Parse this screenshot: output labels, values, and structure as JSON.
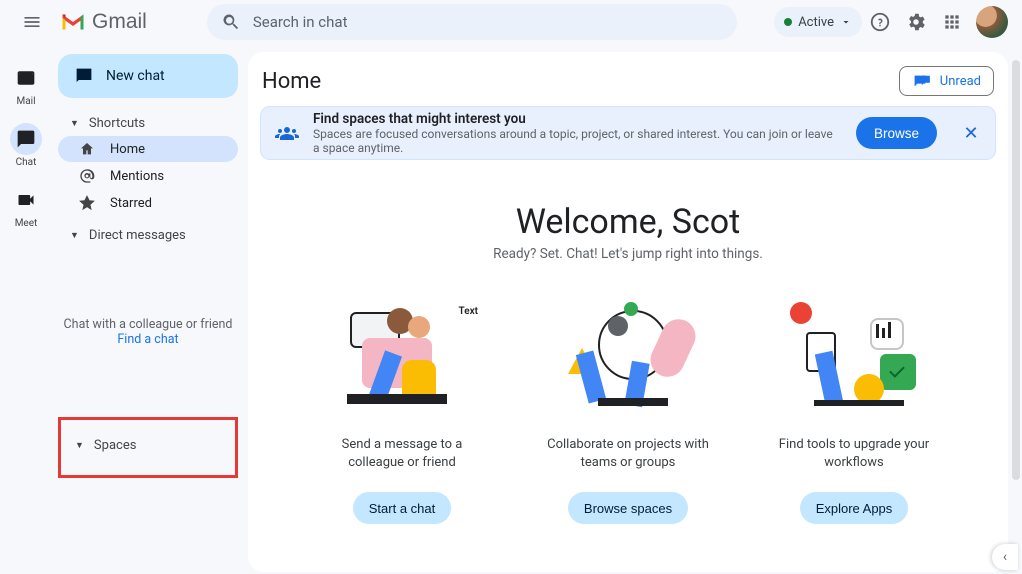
{
  "header": {
    "brand": "Gmail",
    "search_placeholder": "Search in chat",
    "status_label": "Active"
  },
  "rail": {
    "items": [
      {
        "label": "Mail"
      },
      {
        "label": "Chat"
      },
      {
        "label": "Meet"
      }
    ]
  },
  "sidebar": {
    "new_chat": "New chat",
    "shortcuts_label": "Shortcuts",
    "items": [
      {
        "label": "Home"
      },
      {
        "label": "Mentions"
      },
      {
        "label": "Starred"
      }
    ],
    "dm_label": "Direct messages",
    "colleague_text": "Chat with a colleague or friend",
    "find_chat": "Find a chat",
    "spaces_label": "Spaces"
  },
  "main": {
    "title": "Home",
    "unread": "Unread",
    "banner": {
      "title": "Find spaces that might interest you",
      "sub": "Spaces are focused conversations around a topic, project, or shared interest. You can join or leave a space anytime.",
      "browse": "Browse"
    },
    "welcome_title": "Welcome, Scot",
    "welcome_sub": "Ready? Set. Chat! Let's jump right into things.",
    "cards": [
      {
        "text": "Send a message to a colleague or friend",
        "button": "Start a chat"
      },
      {
        "text": "Collaborate on projects with teams or groups",
        "button": "Browse spaces"
      },
      {
        "text": "Find tools to upgrade your workflows",
        "button": "Explore Apps"
      }
    ],
    "illus_text": "Text"
  }
}
